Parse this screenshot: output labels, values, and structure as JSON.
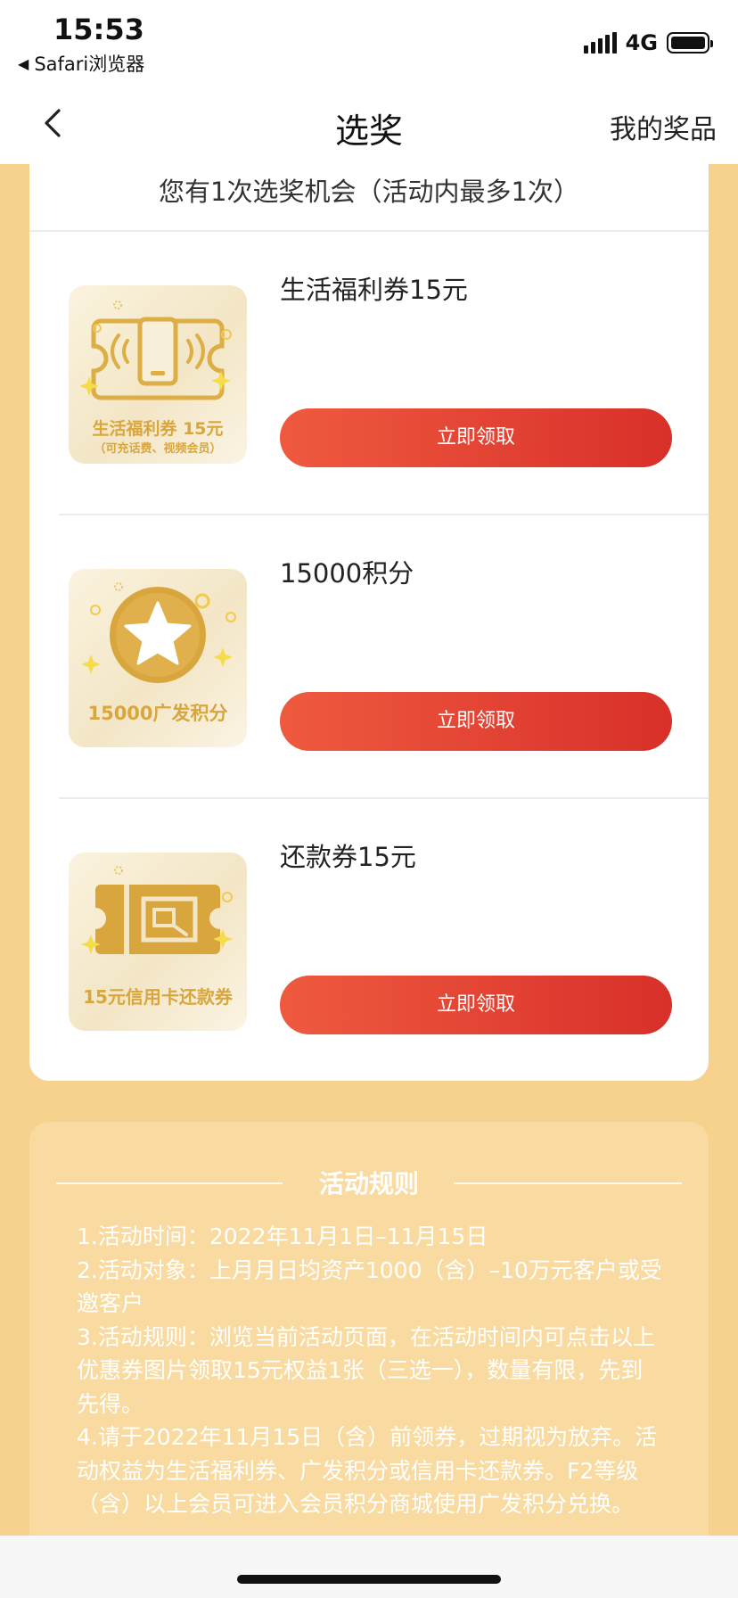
{
  "status_bar": {
    "time": "15:53",
    "back_app": "Safari浏览器",
    "network": "4G"
  },
  "nav": {
    "title": "选奖",
    "right_link": "我的奖品",
    "back_icon": "chevron-left-icon"
  },
  "prize_card": {
    "chance_text": "您有1次选奖机会（活动内最多1次）",
    "prizes": [
      {
        "name": "生活福利券15元",
        "image_caption": "生活福利券 15元",
        "image_subcaption": "（可充话费、视频会员）",
        "image_icon": "phone-ticket-icon",
        "button": "立即领取"
      },
      {
        "name": "15000积分",
        "image_caption": "15000广发积分",
        "image_icon": "star-coin-icon",
        "button": "立即领取"
      },
      {
        "name": "还款券15元",
        "image_caption": "15元信用卡还款券",
        "image_icon": "repayment-ticket-icon",
        "button": "立即领取"
      }
    ]
  },
  "rules": {
    "title": "活动规则",
    "lines": [
      "1.活动时间：2022年11月1日–11月15日",
      "2.活动对象：上月月日均资产1000（含）–10万元客户或受邀客户",
      "3.活动规则：浏览当前活动页面，在活动时间内可点击以上优惠券图片领取15元权益1张（三选一），数量有限，先到先得。",
      "4.请于2022年11月15日（含）前领券，过期视为放弃。活动权益为生活福利券、广发积分或信用卡还款券。F2等级（含）以上会员可进入会员积分商城使用广发积分兑换。"
    ]
  },
  "colors": {
    "page_bg": "#f7d28f",
    "button_start": "#ef5a3f",
    "button_end": "#d8302a",
    "gold": "#d9a63e"
  }
}
